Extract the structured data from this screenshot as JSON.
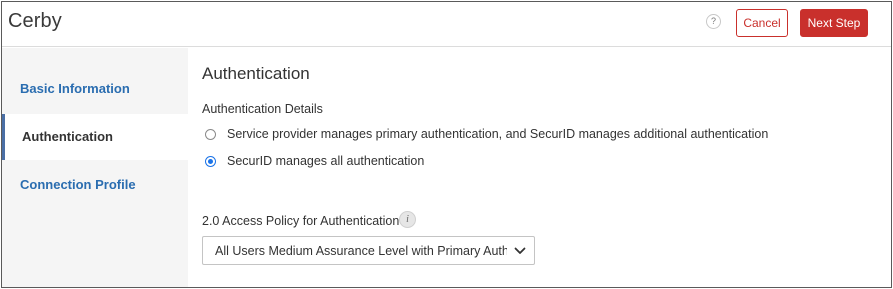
{
  "header": {
    "app_title": "Cerby",
    "help_label": "?",
    "cancel_label": "Cancel",
    "next_label": "Next Step"
  },
  "sidebar": {
    "items": [
      {
        "label": "Basic Information",
        "active": false
      },
      {
        "label": "Authentication",
        "active": true
      },
      {
        "label": "Connection Profile",
        "active": false
      }
    ]
  },
  "main": {
    "section_title": "Authentication",
    "details_title": "Authentication Details",
    "options": [
      {
        "label": "Service provider manages primary authentication, and SecurID manages additional authentication",
        "checked": false
      },
      {
        "label": "SecurID manages all authentication",
        "checked": true
      }
    ],
    "policy_label": "2.0 Access Policy for Authentication",
    "info_glyph": "i",
    "policy_select_value": "All Users Medium Assurance Level with Primary Authe"
  },
  "colors": {
    "accent_red": "#c9302c",
    "link_blue": "#2a6db0",
    "radio_blue": "#1a73e8",
    "sidebar_bg": "#f5f5f5"
  },
  "icons": {
    "help": "question-icon",
    "info": "info-icon",
    "select": "chevron-down-icon"
  }
}
